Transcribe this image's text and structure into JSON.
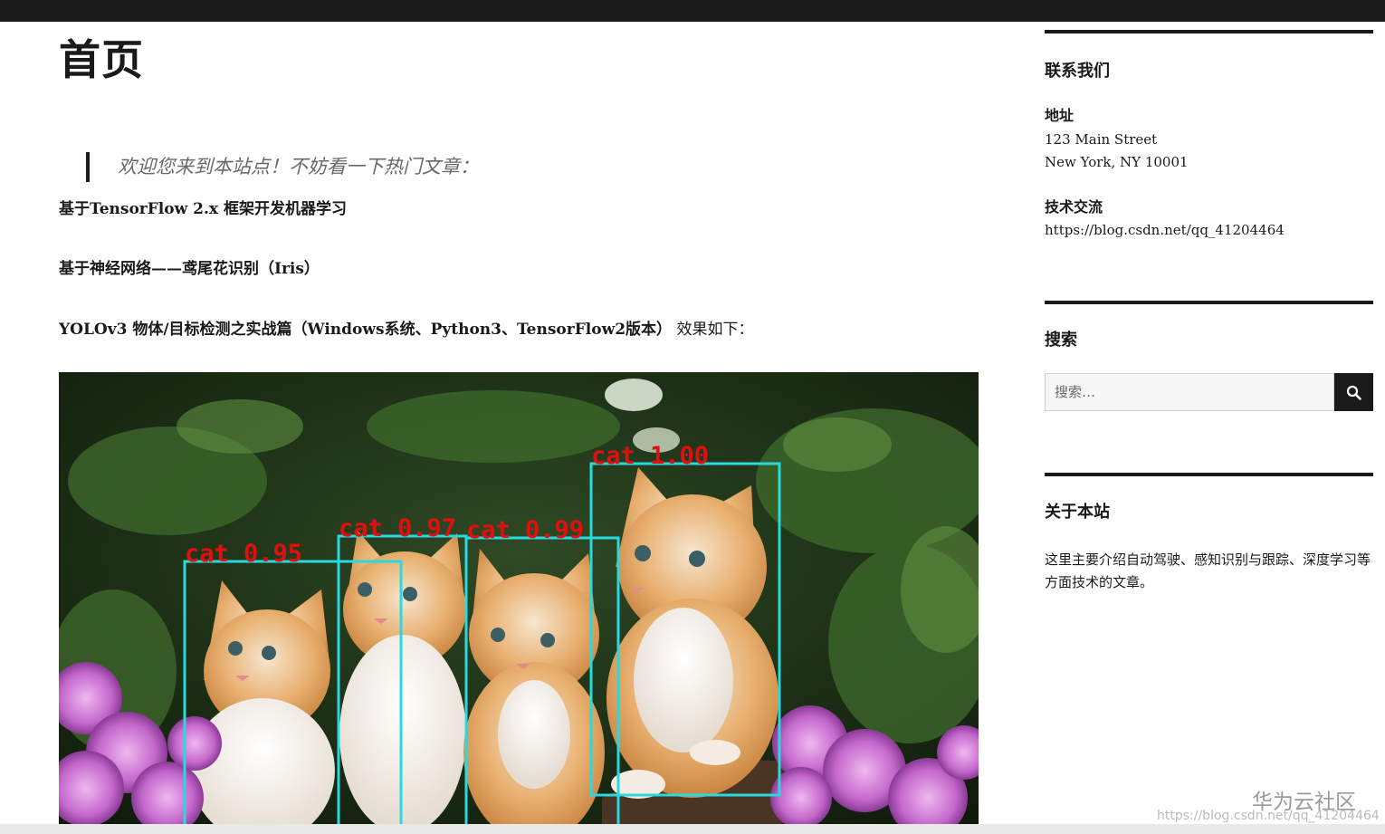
{
  "page": {
    "title": "首页",
    "intro": "欢迎您来到本站点！不妨看一下热门文章："
  },
  "articles": [
    {
      "title": "基于TensorFlow 2.x 框架开发机器学习",
      "suffix": ""
    },
    {
      "title": "基于神经网络——鸢尾花识别（Iris）",
      "suffix": ""
    },
    {
      "title": "YOLOv3 物体/目标检测之实战篇（Windows系统、Python3、TensorFlow2版本）",
      "suffix": " 效果如下："
    }
  ],
  "detections": [
    {
      "label": "cat 0.95"
    },
    {
      "label": "cat 0.97"
    },
    {
      "label": "cat 0.99"
    },
    {
      "label": "cat 1.00"
    }
  ],
  "colors": {
    "box": "#29d9e0",
    "label": "#e01010",
    "dark": "#1a1a1a"
  },
  "sidebar": {
    "contact": {
      "title": "联系我们",
      "address_label": "地址",
      "address_line1": "123 Main Street",
      "address_line2": "New York, NY 10001",
      "tech_label": "技术交流",
      "tech_link": "https://blog.csdn.net/qq_41204464"
    },
    "search": {
      "title": "搜索",
      "placeholder": "搜索…",
      "button_icon": "search-icon"
    },
    "about": {
      "title": "关于本站",
      "text": "这里主要介绍自动驾驶、感知识别与跟踪、深度学习等方面技术的文章。"
    }
  },
  "watermark": {
    "brand": "华为云社区",
    "url": "https://blog.csdn.net/qq_41204464"
  }
}
